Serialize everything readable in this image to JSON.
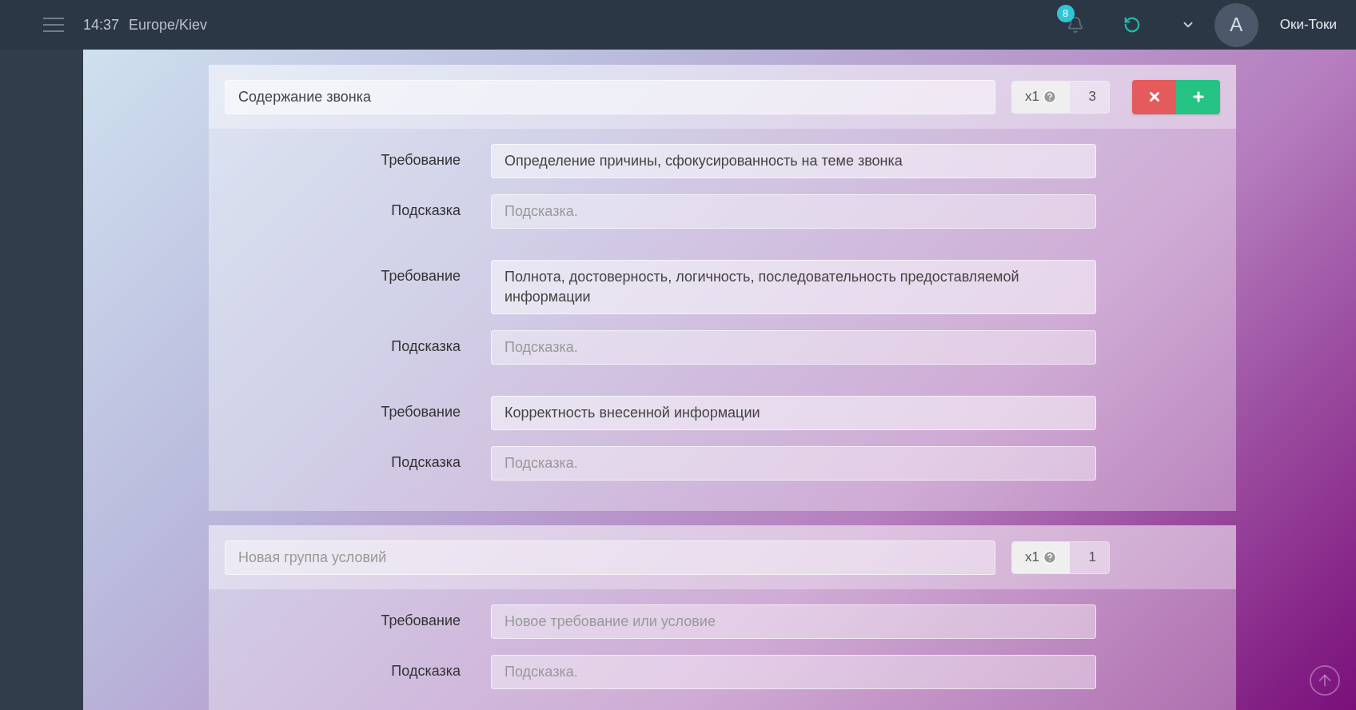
{
  "topbar": {
    "time": "14:37",
    "timezone": "Europe/Kiev",
    "notifications": "8",
    "avatar_letter": "A",
    "username": "Оки-Токи"
  },
  "groups": [
    {
      "title": {
        "value": "Содержание звонка"
      },
      "multiplier": "x1",
      "count": "3",
      "buttons": [
        {
          "kind": "delete"
        },
        {
          "kind": "add"
        }
      ],
      "rows": [
        {
          "label": "Требование",
          "value": "Определение причины, сфокусированность на теме звонка"
        },
        {
          "label": "Подсказка",
          "placeholder": "Подсказка."
        },
        {
          "label": "Требование",
          "value": "Полнота, достоверность, логичность, последовательность предоставляемой информации"
        },
        {
          "label": "Подсказка",
          "placeholder": "Подсказка."
        },
        {
          "label": "Требование",
          "value": "Корректность внесенной информации"
        },
        {
          "label": "Подсказка",
          "placeholder": "Подсказка."
        }
      ]
    },
    {
      "title": {
        "placeholder": "Новая группа условий"
      },
      "multiplier": "x1",
      "count": "1",
      "rows": [
        {
          "label": "Требование",
          "placeholder": "Новое требование или условие"
        },
        {
          "label": "Подсказка",
          "placeholder": "Подсказка."
        }
      ]
    }
  ]
}
